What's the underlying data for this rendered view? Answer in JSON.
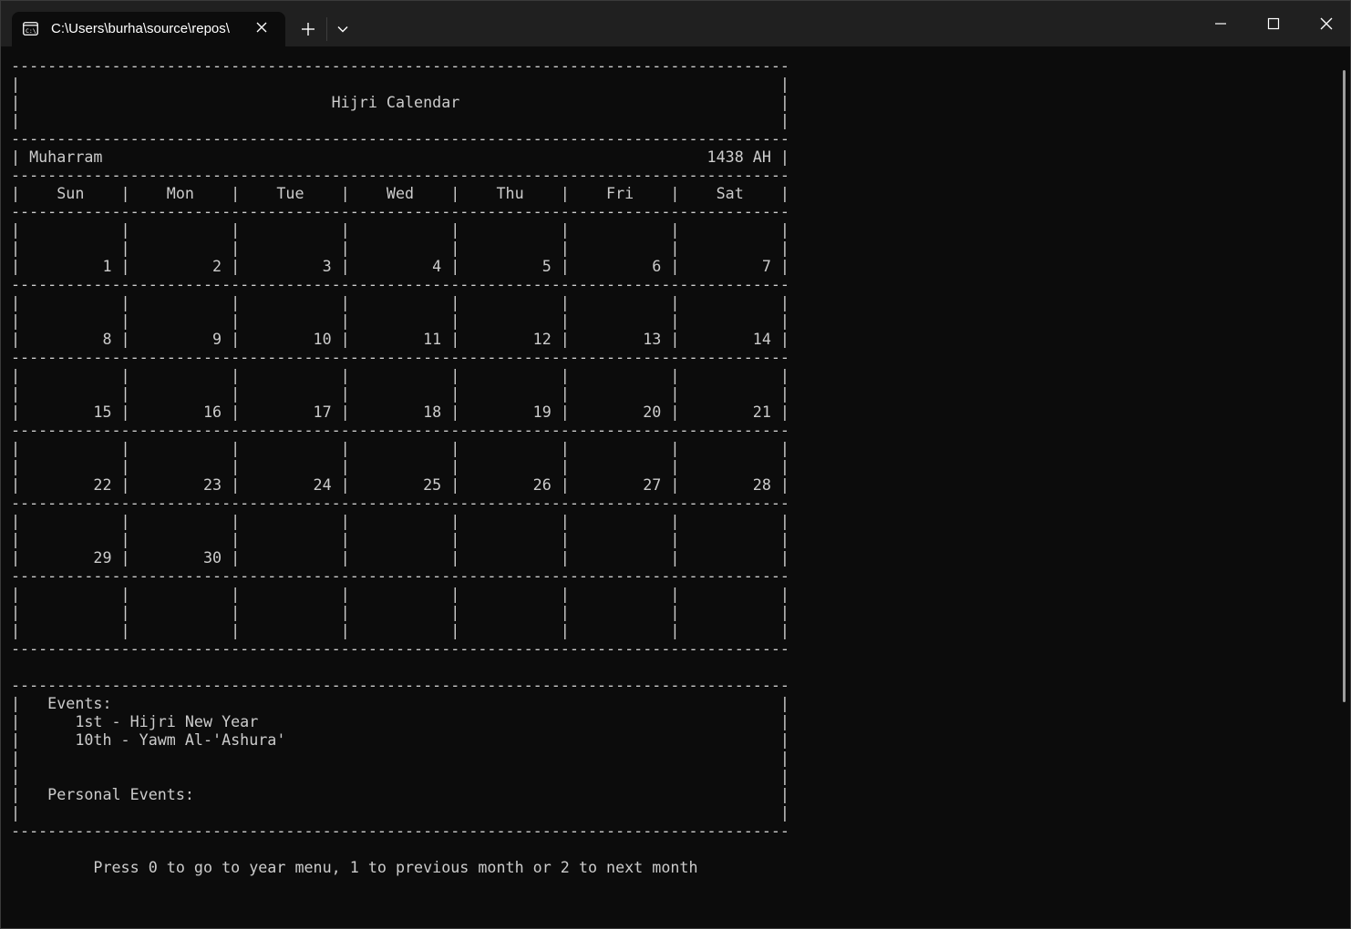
{
  "window": {
    "tab_title": "C:\\Users\\burha\\source\\repos\\",
    "icons": {
      "tab": "terminal-icon",
      "tab_close": "close-icon",
      "new_tab": "plus-icon",
      "dropdown": "chevron-down-icon",
      "minimize": "minimize-icon",
      "maximize": "maximize-icon",
      "close": "close-icon"
    }
  },
  "calendar": {
    "title": "Hijri Calendar",
    "month": "Muharram",
    "year": "1438 AH",
    "weekdays": [
      "Sun",
      "Mon",
      "Tue",
      "Wed",
      "Thu",
      "Fri",
      "Sat"
    ],
    "weeks": [
      [
        "1",
        "2",
        "3",
        "4",
        "5",
        "6",
        "7"
      ],
      [
        "8",
        "9",
        "10",
        "11",
        "12",
        "13",
        "14"
      ],
      [
        "15",
        "16",
        "17",
        "18",
        "19",
        "20",
        "21"
      ],
      [
        "22",
        "23",
        "24",
        "25",
        "26",
        "27",
        "28"
      ],
      [
        "29",
        "30",
        "",
        "",
        "",
        "",
        ""
      ],
      [
        "",
        "",
        "",
        "",
        "",
        "",
        ""
      ]
    ],
    "events_label": "Events:",
    "events": [
      "1st - Hijri New Year",
      "10th - Yawm Al-'Ashura'"
    ],
    "personal_events_label": "Personal Events:",
    "personal_events": [],
    "prompt": "Press 0 to go to year menu, 1 to previous month or 2 to next month"
  }
}
